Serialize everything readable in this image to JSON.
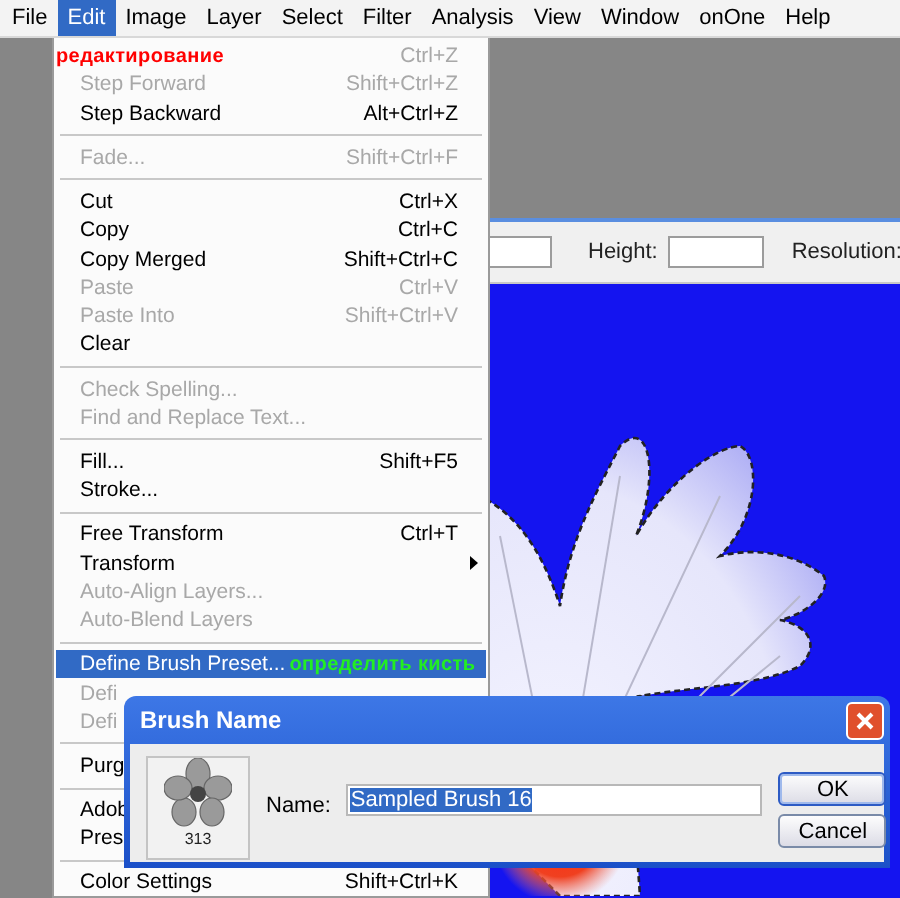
{
  "menubar": [
    {
      "label": "File",
      "selected": false
    },
    {
      "label": "Edit",
      "selected": true
    },
    {
      "label": "Image",
      "selected": false
    },
    {
      "label": "Layer",
      "selected": false
    },
    {
      "label": "Select",
      "selected": false
    },
    {
      "label": "Filter",
      "selected": false
    },
    {
      "label": "Analysis",
      "selected": false
    },
    {
      "label": "View",
      "selected": false
    },
    {
      "label": "Window",
      "selected": false
    },
    {
      "label": "onOne",
      "selected": false
    },
    {
      "label": "Help",
      "selected": false
    }
  ],
  "edit_menu": {
    "items": [
      {
        "kind": "item",
        "shortcut": "Ctrl+Z",
        "disabled": true,
        "selected": false,
        "annotation": {
          "text": "редактирование",
          "color": "#ff0000"
        }
      },
      {
        "kind": "item",
        "label": "Step Forward",
        "shortcut": "Shift+Ctrl+Z",
        "disabled": true,
        "selected": false
      },
      {
        "kind": "item",
        "label": "Step Backward",
        "shortcut": "Alt+Ctrl+Z",
        "disabled": false,
        "selected": false
      },
      {
        "kind": "separator"
      },
      {
        "kind": "item",
        "label": "Fade...",
        "shortcut": "Shift+Ctrl+F",
        "disabled": true,
        "selected": false
      },
      {
        "kind": "separator"
      },
      {
        "kind": "item",
        "label": "Cut",
        "shortcut": "Ctrl+X",
        "disabled": false,
        "selected": false
      },
      {
        "kind": "item",
        "label": "Copy",
        "shortcut": "Ctrl+C",
        "disabled": false,
        "selected": false
      },
      {
        "kind": "item",
        "label": "Copy Merged",
        "shortcut": "Shift+Ctrl+C",
        "disabled": false,
        "selected": false
      },
      {
        "kind": "item",
        "label": "Paste",
        "shortcut": "Ctrl+V",
        "disabled": true,
        "selected": false
      },
      {
        "kind": "item",
        "label": "Paste Into",
        "shortcut": "Shift+Ctrl+V",
        "disabled": true,
        "selected": false
      },
      {
        "kind": "item",
        "label": "Clear",
        "disabled": false,
        "selected": false
      },
      {
        "kind": "separator"
      },
      {
        "kind": "item",
        "label": "Check Spelling...",
        "disabled": true,
        "selected": false
      },
      {
        "kind": "item",
        "label": "Find and Replace Text...",
        "disabled": true,
        "selected": false
      },
      {
        "kind": "separator"
      },
      {
        "kind": "item",
        "label": "Fill...",
        "shortcut": "Shift+F5",
        "disabled": false,
        "selected": false
      },
      {
        "kind": "item",
        "label": "Stroke...",
        "disabled": false,
        "selected": false
      },
      {
        "kind": "separator"
      },
      {
        "kind": "item",
        "label": "Free Transform",
        "shortcut": "Ctrl+T",
        "disabled": false,
        "selected": false
      },
      {
        "kind": "item",
        "label": "Transform",
        "disabled": false,
        "selected": false,
        "submenu": true
      },
      {
        "kind": "item",
        "label": "Auto-Align Layers...",
        "disabled": true,
        "selected": false
      },
      {
        "kind": "item",
        "label": "Auto-Blend Layers",
        "disabled": true,
        "selected": false
      },
      {
        "kind": "separator"
      },
      {
        "kind": "item",
        "label": "Define Brush Preset...",
        "disabled": false,
        "selected": true,
        "annotation": {
          "text": "определить кисть",
          "color": "#22ee22"
        }
      },
      {
        "kind": "item",
        "label": "Defi",
        "disabled": true,
        "selected": false
      },
      {
        "kind": "item",
        "label": "Defi",
        "disabled": true,
        "selected": false
      },
      {
        "kind": "separator"
      },
      {
        "kind": "item",
        "label": "Purg",
        "disabled": false,
        "selected": false
      },
      {
        "kind": "separator"
      },
      {
        "kind": "item",
        "label": "Adob",
        "disabled": false,
        "selected": false
      },
      {
        "kind": "item",
        "label": "Pres",
        "disabled": false,
        "selected": false
      },
      {
        "kind": "separator"
      },
      {
        "kind": "item",
        "label": "Color Settings",
        "shortcut": "Shift+Ctrl+K",
        "disabled": false,
        "selected": false
      }
    ]
  },
  "options_bar": {
    "height_label": "Height:",
    "resolution_label": "Resolution:"
  },
  "dialog": {
    "title": "Brush Name",
    "brush_size": "313",
    "name_label": "Name:",
    "name_value": "Sampled Brush 16",
    "name_selected": true,
    "buttons": [
      {
        "label": "OK",
        "default": true
      },
      {
        "label": "Cancel",
        "default": false
      }
    ]
  }
}
